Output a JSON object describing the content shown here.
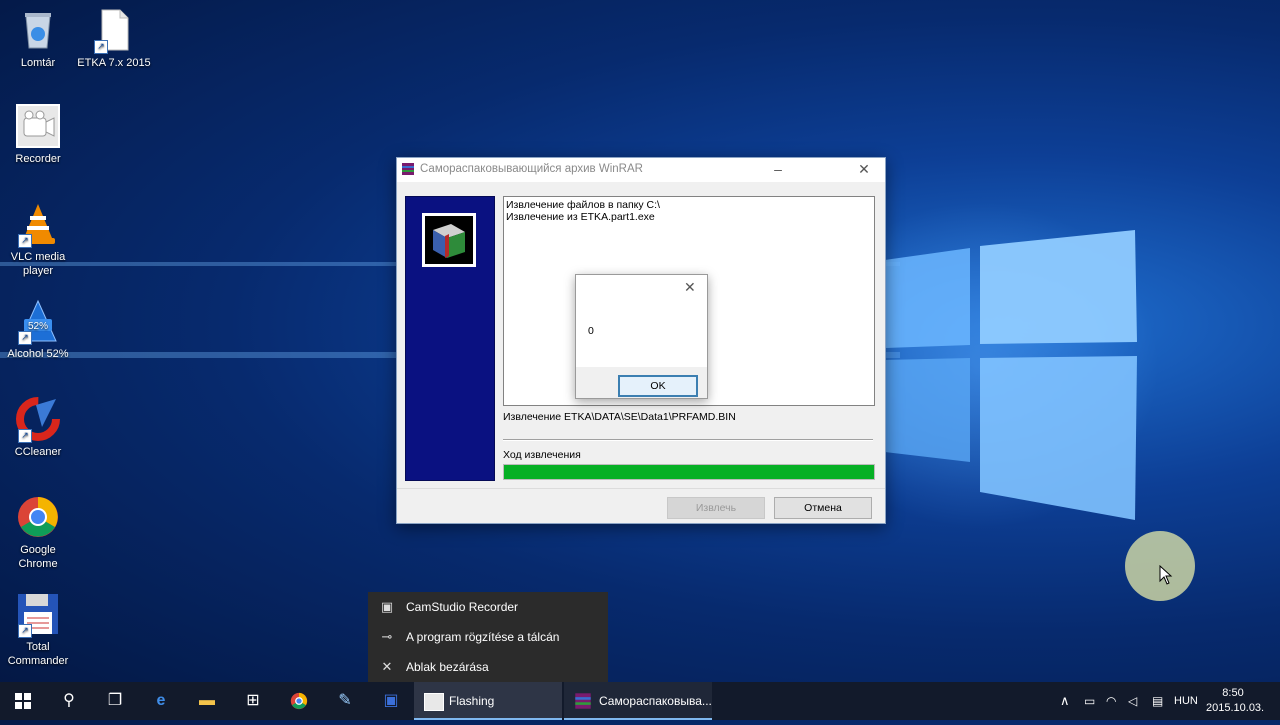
{
  "desktop": {
    "icons": [
      {
        "label": "Lomtár",
        "icon": "recycle-bin-icon"
      },
      {
        "label": "ETKA 7.x 2015",
        "icon": "file-icon"
      },
      {
        "label": "Recorder",
        "icon": "camstudio-icon"
      },
      {
        "label": "VLC media player",
        "icon": "vlc-icon"
      },
      {
        "label": "Alcohol 52%",
        "icon": "alcohol-icon",
        "badge": "52%"
      },
      {
        "label": "CCleaner",
        "icon": "ccleaner-icon"
      },
      {
        "label": "Google Chrome",
        "icon": "chrome-icon"
      },
      {
        "label": "Total Commander",
        "icon": "floppy-icon"
      }
    ]
  },
  "winrar_dialog": {
    "title": "Самораспаковывающийся архив WinRAR",
    "log_lines": [
      "Извлечение файлов в папку C:\\",
      "Извлечение из ETKA.part1.exe"
    ],
    "current_file": "Извлечение ETKA\\DATA\\SE\\Data1\\PRFAMD.BIN",
    "progress_label": "Ход извлечения",
    "progress_value": 1.0,
    "extract_button": "Извлечь",
    "cancel_button": "Отмена"
  },
  "message_box": {
    "value": "0",
    "ok_button": "OK"
  },
  "jump_list": {
    "items": [
      {
        "label": "CamStudio Recorder",
        "icon": "app-icon"
      },
      {
        "label": "A program rögzítése a tálcán",
        "icon": "pin-icon"
      },
      {
        "label": "Ablak bezárása",
        "icon": "close-icon"
      }
    ]
  },
  "taskbar": {
    "apps": [
      {
        "label": "Flashing",
        "icon": "camstudio-icon"
      },
      {
        "label": "Самораспаковыва...",
        "icon": "winrar-icon"
      }
    ],
    "language": "HUN",
    "time": "8:50",
    "date": "2015.10.03."
  },
  "colors": {
    "progress_fill": "#06b025",
    "side_panel": "#0a1181",
    "taskbar": "#121a2b"
  }
}
